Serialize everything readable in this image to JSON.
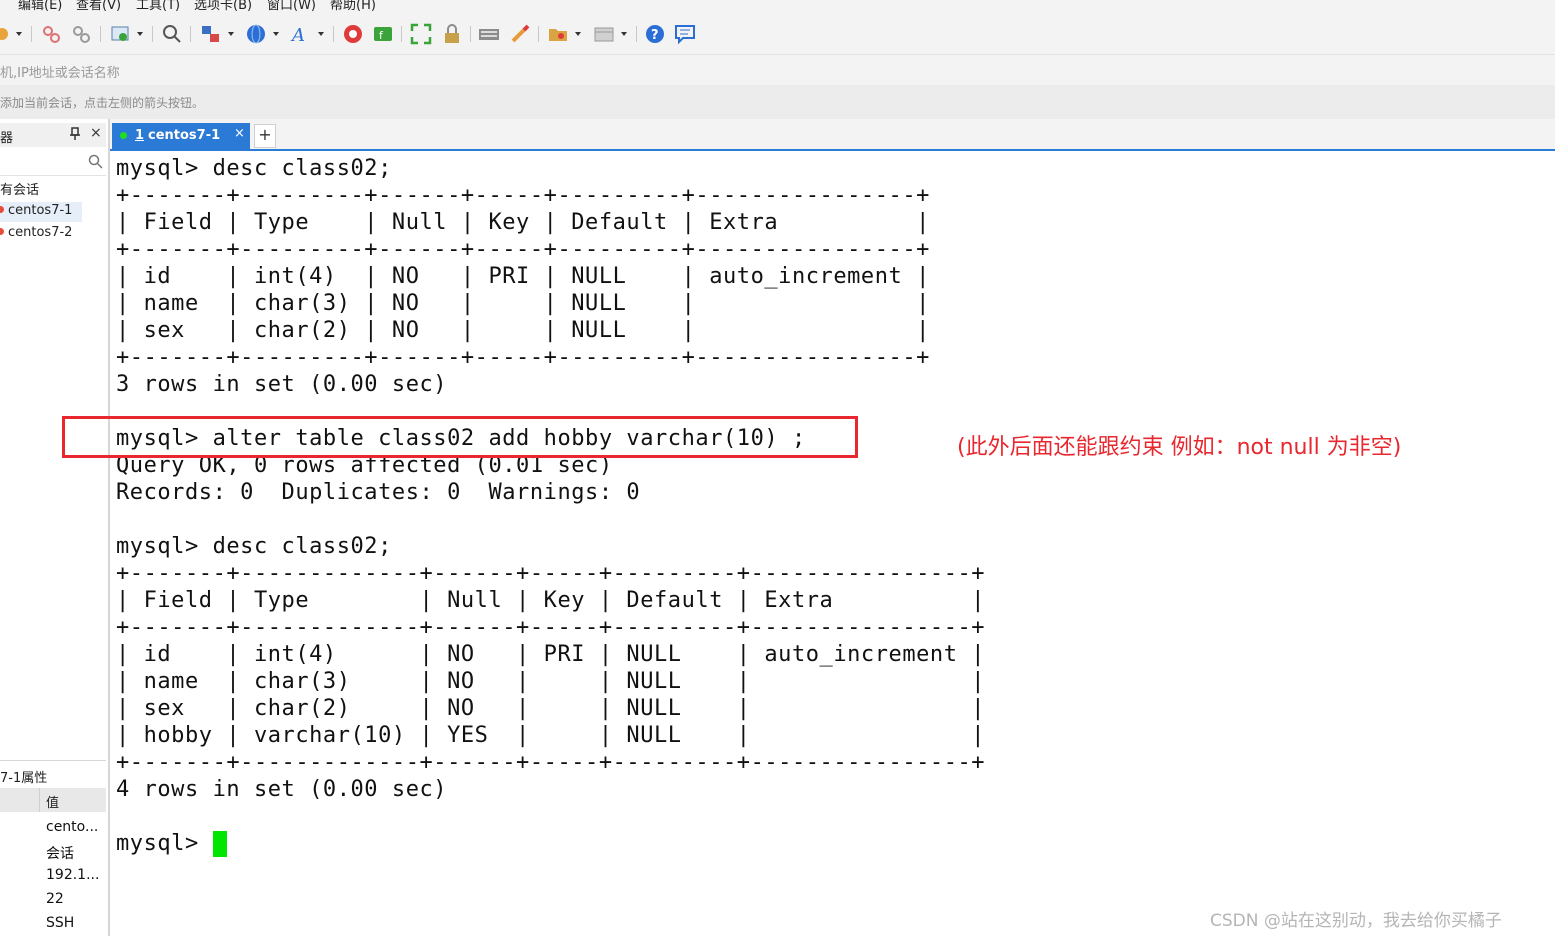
{
  "menubar": {
    "items": [
      "编辑(E)",
      "查看(V)",
      "工具(T)",
      "选项卡(B)",
      "窗口(W)",
      "帮助(H)"
    ]
  },
  "toolbar": {
    "icons": [
      "new-session-icon",
      "disconnect-icon",
      "link-icon",
      "compose-icon",
      "find-icon",
      "transfer-icon",
      "globe-icon",
      "font-icon",
      "xmanager-icon",
      "xftp-icon",
      "fullscreen-icon",
      "lock-icon",
      "keyboard-icon",
      "highlight-icon",
      "new-folder-icon",
      "layout-icon",
      "help-icon",
      "feedback-icon"
    ],
    "colors": {
      "red": "#e03b3b",
      "green": "#3aa33a",
      "blue": "#2b6fd6",
      "gray": "#8c8c8c"
    }
  },
  "address_bar": {
    "placeholder": "机,IP地址或会话名称"
  },
  "hint_bar": {
    "text": "添加当前会话，点击左侧的箭头按钮。"
  },
  "session_manager": {
    "title": "器",
    "pin": "ᵖ",
    "close": "×",
    "root": "有会话",
    "sessions": [
      "centos7-1",
      "centos7-2"
    ]
  },
  "properties": {
    "title": "7-1属性",
    "column_value": "值",
    "values": [
      "cento...",
      "会话",
      "192.1...",
      "22",
      "SSH"
    ]
  },
  "tabs": [
    {
      "number": "1",
      "title": "centos7-1",
      "close": "×"
    }
  ],
  "new_tab": "+",
  "terminal": {
    "lines": [
      "mysql> desc class02;",
      "+-------+---------+------+-----+---------+----------------+",
      "| Field | Type    | Null | Key | Default | Extra          |",
      "+-------+---------+------+-----+---------+----------------+",
      "| id    | int(4)  | NO   | PRI | NULL    | auto_increment |",
      "| name  | char(3) | NO   |     | NULL    |                |",
      "| sex   | char(2) | NO   |     | NULL    |                |",
      "+-------+---------+------+-----+---------+----------------+",
      "3 rows in set (0.00 sec)",
      "",
      "mysql> alter table class02 add hobby varchar(10) ;",
      "Query OK, 0 rows affected (0.01 sec)",
      "Records: 0  Duplicates: 0  Warnings: 0",
      "",
      "mysql> desc class02;",
      "+-------+-------------+------+-----+---------+----------------+",
      "| Field | Type        | Null | Key | Default | Extra          |",
      "+-------+-------------+------+-----+---------+----------------+",
      "| id    | int(4)      | NO   | PRI | NULL    | auto_increment |",
      "| name  | char(3)     | NO   |     | NULL    |                |",
      "| sex   | char(2)     | NO   |     | NULL    |                |",
      "| hobby | varchar(10) | YES  |     | NULL    |                |",
      "+-------+-------------+------+-----+---------+----------------+",
      "4 rows in set (0.00 sec)",
      "",
      "mysql> "
    ],
    "cursor_color": "#00e600"
  },
  "annotation": {
    "text": "(此外后面还能跟约束  例如：not  null   为非空)",
    "color": "#e8272e"
  },
  "watermark": "CSDN @站在这别动，我去给你买橘子"
}
